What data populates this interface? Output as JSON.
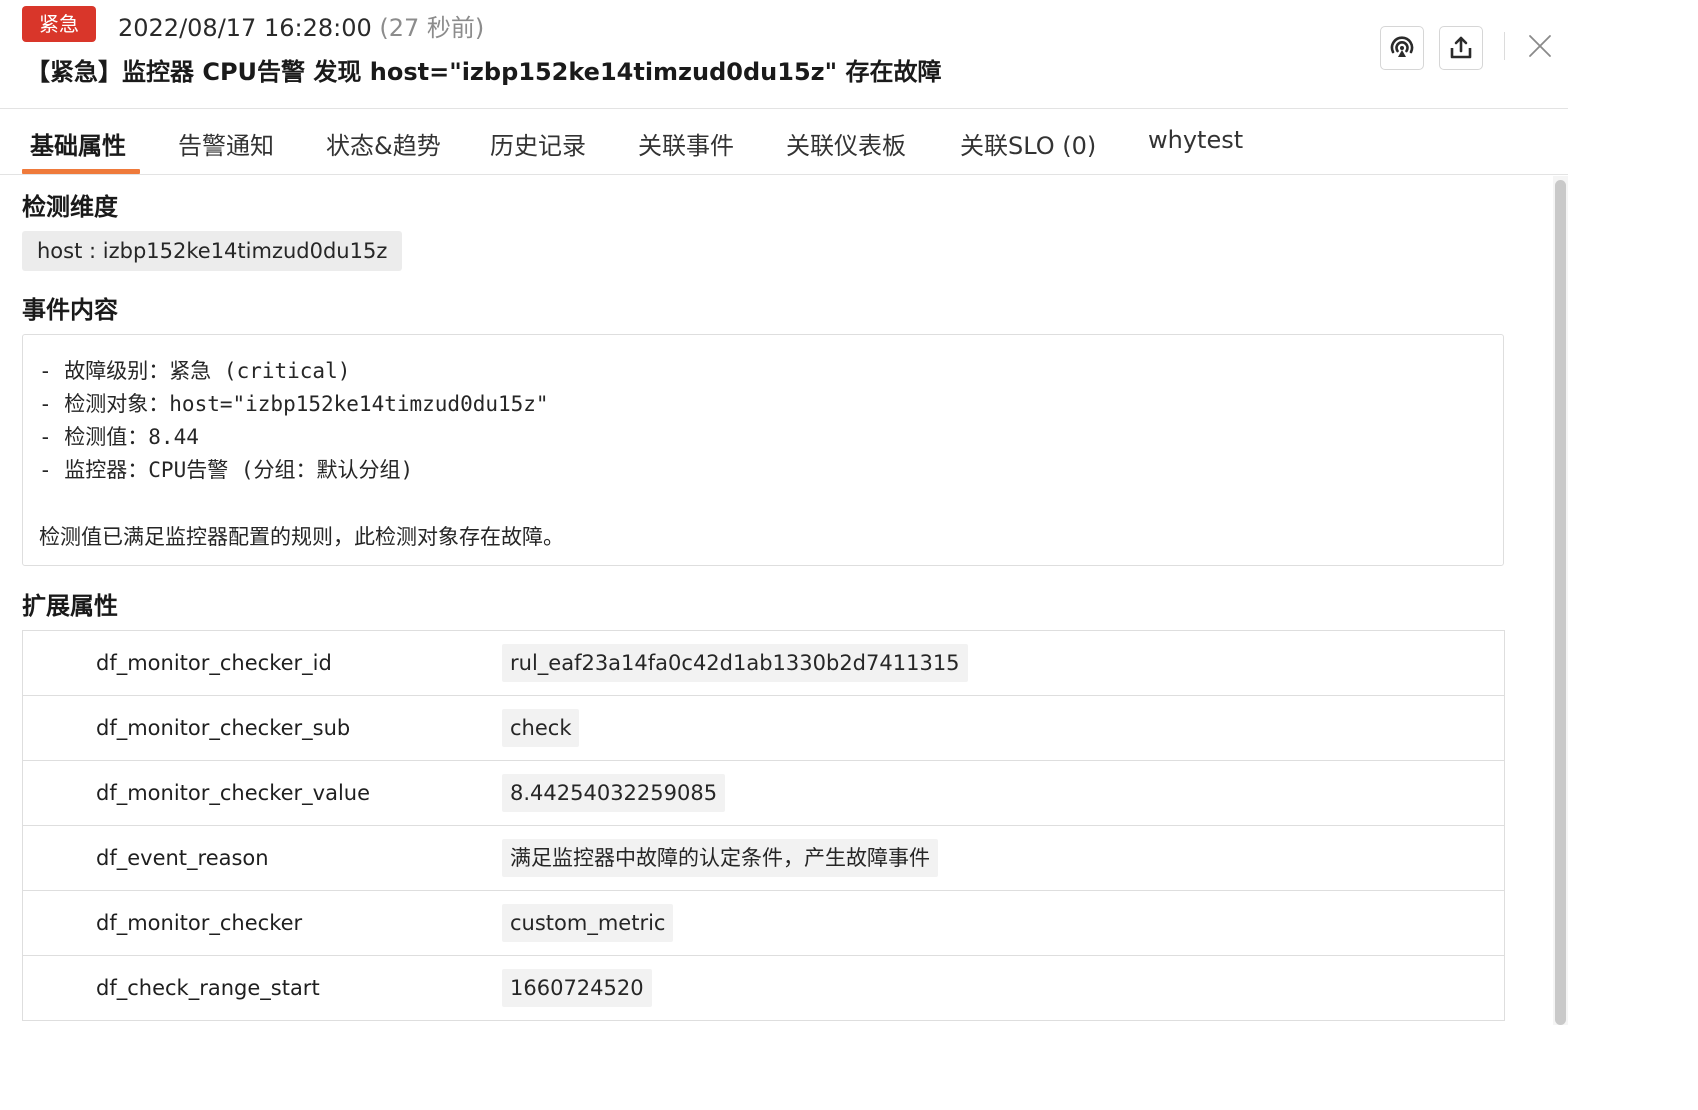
{
  "header": {
    "severity_badge": "紧急",
    "time": "2022/08/17 16:28:00",
    "time_ago": "(27 秒前)",
    "title": "【紧急】监控器 CPU告警 发现 host=\"izbp152ke14timzud0du15z\" 存在故障",
    "icons": [
      "signal-icon",
      "export-icon",
      "close-icon"
    ]
  },
  "tabs": [
    {
      "label": "基础属性",
      "active": true
    },
    {
      "label": "告警通知"
    },
    {
      "label": "状态&趋势"
    },
    {
      "label": "历史记录"
    },
    {
      "label": "关联事件"
    },
    {
      "label": "关联仪表板"
    },
    {
      "label": "关联SLO (0)"
    },
    {
      "label": "whytest"
    }
  ],
  "dimension": {
    "title": "检测维度",
    "tag": "host : izbp152ke14timzud0du15z"
  },
  "event_content": {
    "title": "事件内容",
    "lines": [
      "- 故障级别：紧急 (critical)",
      "- 检测对象：host=\"izbp152ke14timzud0du15z\"",
      "- 检测值：8.44",
      "- 监控器：CPU告警 (分组：默认分组)"
    ],
    "summary": "检测值已满足监控器配置的规则，此检测对象存在故障。"
  },
  "extended": {
    "title": "扩展属性",
    "rows": [
      {
        "key": "df_monitor_checker_id",
        "value": "rul_eaf23a14fa0c42d1ab1330b2d7411315"
      },
      {
        "key": "df_monitor_checker_sub",
        "value": "check"
      },
      {
        "key": "df_monitor_checker_value",
        "value": "8.44254032259085"
      },
      {
        "key": "df_event_reason",
        "value": "满足监控器中故障的认定条件，产生故障事件"
      },
      {
        "key": "df_monitor_checker",
        "value": "custom_metric"
      },
      {
        "key": "df_check_range_start",
        "value": "1660724520"
      }
    ]
  },
  "colors": {
    "badge": "#d9362a",
    "tab_underline": "#ef7a3b"
  }
}
